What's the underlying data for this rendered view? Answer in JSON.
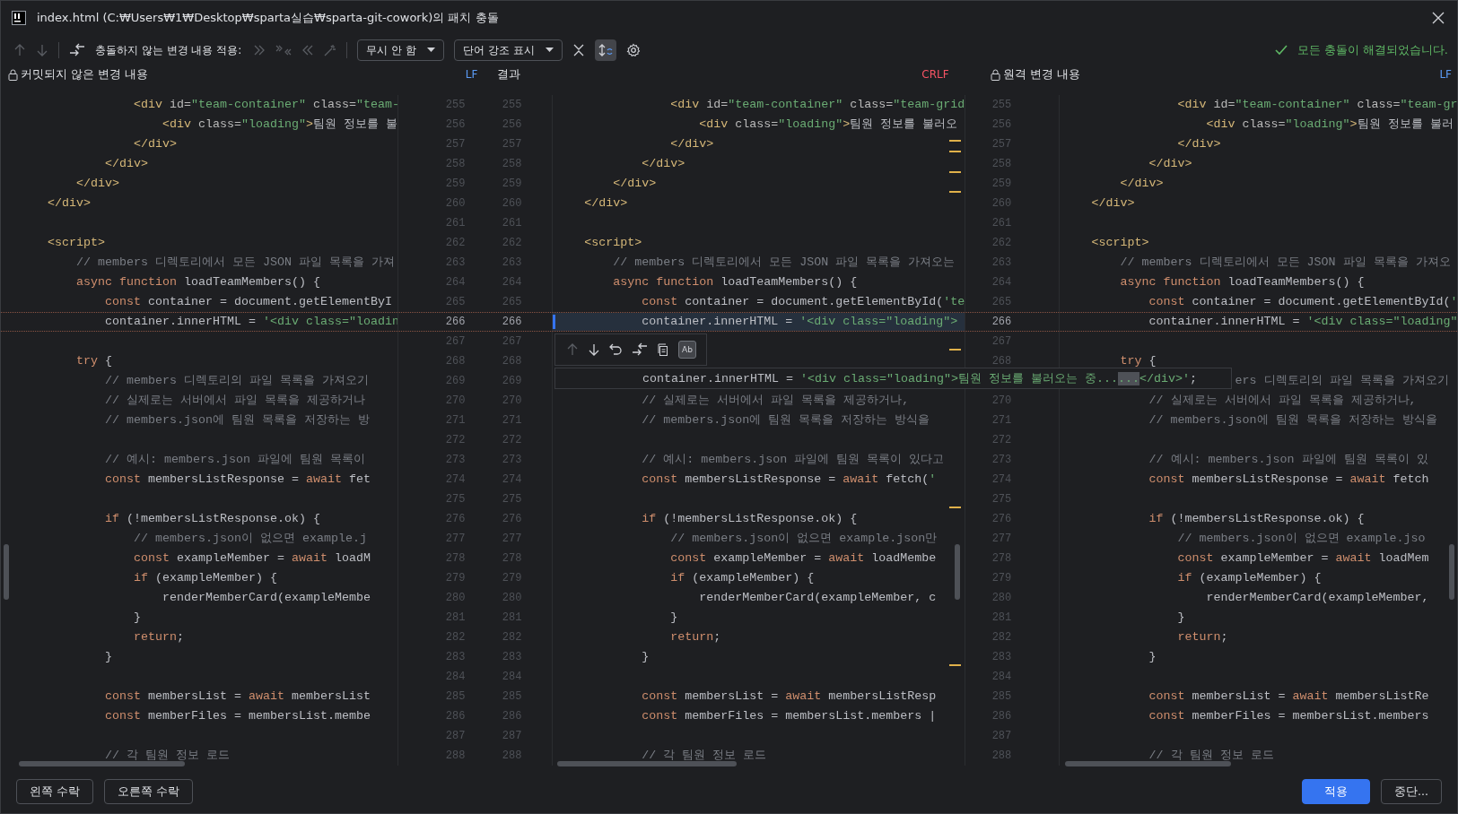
{
  "window": {
    "title": "index.html (C:₩Users₩1₩Desktop₩sparta실습₩sparta-git-cowork)의 패치 충돌"
  },
  "toolbar": {
    "apply_label": "충돌하지 않는 변경 내용 적용:",
    "dropdowns": [
      {
        "label": "무시 안 함"
      },
      {
        "label": "단어 강조 표시"
      }
    ],
    "sync_scroll": {
      "selected": true
    },
    "status": "모든 충돌이 해결되었습니다."
  },
  "headers": {
    "left": {
      "title": "커밋되지 않은 변경 내용",
      "line_ending": "LF",
      "mismatch": false
    },
    "result": {
      "title": "결과",
      "line_ending": "CRLF",
      "mismatch": true
    },
    "right": {
      "title": "원격 변경 내용",
      "line_ending": "LF",
      "mismatch": false
    }
  },
  "rows": [
    {
      "left_no": "255",
      "result_no": "255",
      "right_no": "255",
      "conflict": false,
      "left": [
        {
          "kind": "tag",
          "text": "                <div"
        },
        {
          "kind": "attr",
          "text": " id="
        },
        {
          "kind": "str",
          "text": "\"team-container\""
        },
        {
          "kind": "attr",
          "text": " class="
        },
        {
          "kind": "str",
          "text": "\"team-"
        }
      ],
      "result": [
        {
          "kind": "tag",
          "text": "                <div"
        },
        {
          "kind": "attr",
          "text": " id="
        },
        {
          "kind": "str",
          "text": "\"team-container\""
        },
        {
          "kind": "attr",
          "text": " class="
        },
        {
          "kind": "str",
          "text": "\"team-grid"
        }
      ],
      "right": [
        {
          "kind": "tag",
          "text": "                <div"
        },
        {
          "kind": "attr",
          "text": " id="
        },
        {
          "kind": "str",
          "text": "\"team-container\""
        },
        {
          "kind": "attr",
          "text": " class="
        },
        {
          "kind": "str",
          "text": "\"team-gr"
        }
      ]
    },
    {
      "left_no": "256",
      "result_no": "256",
      "right_no": "256",
      "conflict": false,
      "left": [
        {
          "kind": "tag",
          "text": "                    <div"
        },
        {
          "kind": "attr",
          "text": " class="
        },
        {
          "kind": "str",
          "text": "\"loading\""
        },
        {
          "kind": "tag",
          "text": ">"
        },
        {
          "kind": "plain",
          "text": "팀원 정보를 불"
        }
      ],
      "result": [
        {
          "kind": "tag",
          "text": "                    <div"
        },
        {
          "kind": "attr",
          "text": " class="
        },
        {
          "kind": "str",
          "text": "\"loading\""
        },
        {
          "kind": "tag",
          "text": ">"
        },
        {
          "kind": "plain",
          "text": "팀원 정보를 불러오"
        }
      ],
      "right": [
        {
          "kind": "tag",
          "text": "                    <div"
        },
        {
          "kind": "attr",
          "text": " class="
        },
        {
          "kind": "str",
          "text": "\"loading\""
        },
        {
          "kind": "tag",
          "text": ">"
        },
        {
          "kind": "plain",
          "text": "팀원 정보를 불러"
        }
      ]
    },
    {
      "left_no": "257",
      "result_no": "257",
      "right_no": "257",
      "conflict": false,
      "marker": {
        "kind": "double"
      },
      "left": [
        {
          "kind": "tag",
          "text": "                </div>"
        }
      ],
      "result": [
        {
          "kind": "tag",
          "text": "                </div>"
        }
      ],
      "right": [
        {
          "kind": "tag",
          "text": "                </div>"
        }
      ]
    },
    {
      "left_no": "258",
      "result_no": "258",
      "right_no": "258",
      "conflict": false,
      "marker": {
        "kind": "single"
      },
      "left": [
        {
          "kind": "tag",
          "text": "            </div>"
        }
      ],
      "result": [
        {
          "kind": "tag",
          "text": "            </div>"
        }
      ],
      "right": [
        {
          "kind": "tag",
          "text": "            </div>"
        }
      ]
    },
    {
      "left_no": "259",
      "result_no": "259",
      "right_no": "259",
      "conflict": false,
      "marker": {
        "kind": "single"
      },
      "left": [
        {
          "kind": "tag",
          "text": "        </div>"
        }
      ],
      "result": [
        {
          "kind": "tag",
          "text": "        </div>"
        }
      ],
      "right": [
        {
          "kind": "tag",
          "text": "        </div>"
        }
      ]
    },
    {
      "left_no": "260",
      "result_no": "260",
      "right_no": "260",
      "conflict": false,
      "left": [
        {
          "kind": "tag",
          "text": "    </div>"
        }
      ],
      "result": [
        {
          "kind": "tag",
          "text": "    </div>"
        }
      ],
      "right": [
        {
          "kind": "tag",
          "text": "    </div>"
        }
      ]
    },
    {
      "left_no": "261",
      "result_no": "261",
      "right_no": "261",
      "conflict": false,
      "left": [],
      "result": [],
      "right": []
    },
    {
      "left_no": "262",
      "result_no": "262",
      "right_no": "262",
      "conflict": false,
      "left": [
        {
          "kind": "tag",
          "text": "    <script>"
        }
      ],
      "result": [
        {
          "kind": "tag",
          "text": "    <script>"
        }
      ],
      "right": [
        {
          "kind": "tag",
          "text": "    <script>"
        }
      ]
    },
    {
      "left_no": "263",
      "result_no": "263",
      "right_no": "263",
      "conflict": false,
      "left": [
        {
          "kind": "comment",
          "text": "        // members 디렉토리에서 모든 JSON 파일 목록을 가져"
        }
      ],
      "result": [
        {
          "kind": "comment",
          "text": "        // members 디렉토리에서 모든 JSON 파일 목록을 가져오는"
        }
      ],
      "right": [
        {
          "kind": "comment",
          "text": "        // members 디렉토리에서 모든 JSON 파일 목록을 가져오"
        }
      ]
    },
    {
      "left_no": "264",
      "result_no": "264",
      "right_no": "264",
      "conflict": false,
      "left": [
        {
          "kind": "kw",
          "text": "        async function"
        },
        {
          "kind": "plain",
          "text": " loadTeamMembers() {"
        }
      ],
      "result": [
        {
          "kind": "kw",
          "text": "        async function"
        },
        {
          "kind": "plain",
          "text": " loadTeamMembers() {"
        }
      ],
      "right": [
        {
          "kind": "kw",
          "text": "        async function"
        },
        {
          "kind": "plain",
          "text": " loadTeamMembers() {"
        }
      ]
    },
    {
      "left_no": "265",
      "result_no": "265",
      "right_no": "265",
      "conflict": false,
      "left": [
        {
          "kind": "kw",
          "text": "            const"
        },
        {
          "kind": "plain",
          "text": " container = document.getElementByI"
        }
      ],
      "result": [
        {
          "kind": "kw",
          "text": "            const"
        },
        {
          "kind": "plain",
          "text": " container = document.getElementById("
        },
        {
          "kind": "str",
          "text": "'te"
        }
      ],
      "right": [
        {
          "kind": "kw",
          "text": "            const"
        },
        {
          "kind": "plain",
          "text": " container = document.getElementById("
        },
        {
          "kind": "str",
          "text": "'"
        }
      ]
    },
    {
      "left_no": "266",
      "result_no": "266",
      "right_no": "266",
      "conflict": true,
      "left": [
        {
          "kind": "plain",
          "text": "            container.innerHTML = "
        },
        {
          "kind": "str",
          "text": "'<div class=\"loadin"
        }
      ],
      "result": [
        {
          "kind": "plain",
          "text": "            container.innerHTML = "
        },
        {
          "kind": "str",
          "text": "'<div class=\"loading\">"
        }
      ],
      "right": [
        {
          "kind": "plain",
          "text": "            container.innerHTML = "
        },
        {
          "kind": "str",
          "text": "'<div class=\"loading\""
        }
      ]
    },
    {
      "left_no": "267",
      "result_no": "267",
      "right_no": "267",
      "conflict": false,
      "marker": {
        "kind": "single"
      },
      "left": [],
      "result": [],
      "right": []
    },
    {
      "left_no": "268",
      "result_no": "268",
      "right_no": "268",
      "conflict": false,
      "left": [
        {
          "kind": "kw",
          "text": "        try"
        },
        {
          "kind": "plain",
          "text": " {"
        }
      ],
      "result": [],
      "right": [
        {
          "kind": "kw",
          "text": "        try"
        },
        {
          "kind": "plain",
          "text": " {"
        }
      ]
    },
    {
      "left_no": "269",
      "result_no": "269",
      "conflict": false,
      "left": [
        {
          "kind": "comment",
          "text": "            // members 디렉토리의 파일 목록을 가져오기"
        }
      ],
      "result": [],
      "right": [
        {
          "kind": "comment",
          "text": "                        ers 디렉토리의 파일 목록을 가져오기"
        }
      ]
    },
    {
      "left_no": "270",
      "result_no": "270",
      "right_no": "270",
      "conflict": false,
      "left": [
        {
          "kind": "comment",
          "text": "            // 실제로는 서버에서 파일 목록을 제공하거나"
        }
      ],
      "result": [
        {
          "kind": "comment",
          "text": "            // 실제로는 서버에서 파일 목록을 제공하거나,"
        }
      ],
      "right": [
        {
          "kind": "comment",
          "text": "            // 실제로는 서버에서 파일 목록을 제공하거나,"
        }
      ]
    },
    {
      "left_no": "271",
      "result_no": "271",
      "right_no": "271",
      "conflict": false,
      "left": [
        {
          "kind": "comment",
          "text": "            // members.json에 팀원 목록을 저장하는 방"
        }
      ],
      "result": [
        {
          "kind": "comment",
          "text": "            // members.json에 팀원 목록을 저장하는 방식을"
        }
      ],
      "right": [
        {
          "kind": "comment",
          "text": "            // members.json에 팀원 목록을 저장하는 방식을"
        }
      ]
    },
    {
      "left_no": "272",
      "result_no": "272",
      "right_no": "272",
      "conflict": false,
      "left": [],
      "result": [],
      "right": []
    },
    {
      "left_no": "273",
      "result_no": "273",
      "right_no": "273",
      "conflict": false,
      "left": [
        {
          "kind": "comment",
          "text": "            // 예시: members.json 파일에 팀원 목록이"
        }
      ],
      "result": [
        {
          "kind": "comment",
          "text": "            // 예시: members.json 파일에 팀원 목록이 있다고"
        }
      ],
      "right": [
        {
          "kind": "comment",
          "text": "            // 예시: members.json 파일에 팀원 목록이 있"
        }
      ]
    },
    {
      "left_no": "274",
      "result_no": "274",
      "right_no": "274",
      "conflict": false,
      "left": [
        {
          "kind": "kw",
          "text": "            const"
        },
        {
          "kind": "plain",
          "text": " membersListResponse = "
        },
        {
          "kind": "kw",
          "text": "await"
        },
        {
          "kind": "plain",
          "text": " fet"
        }
      ],
      "result": [
        {
          "kind": "kw",
          "text": "            const"
        },
        {
          "kind": "plain",
          "text": " membersListResponse = "
        },
        {
          "kind": "kw",
          "text": "await"
        },
        {
          "kind": "plain",
          "text": " fetch("
        },
        {
          "kind": "str",
          "text": "'"
        }
      ],
      "right": [
        {
          "kind": "kw",
          "text": "            const"
        },
        {
          "kind": "plain",
          "text": " membersListResponse = "
        },
        {
          "kind": "kw",
          "text": "await"
        },
        {
          "kind": "plain",
          "text": " fetch"
        }
      ]
    },
    {
      "left_no": "275",
      "result_no": "275",
      "right_no": "275",
      "conflict": false,
      "marker": {
        "kind": "single"
      },
      "left": [],
      "result": [],
      "right": []
    },
    {
      "left_no": "276",
      "result_no": "276",
      "right_no": "276",
      "conflict": false,
      "left": [
        {
          "kind": "kw",
          "text": "            if"
        },
        {
          "kind": "plain",
          "text": " (!membersListResponse.ok) {"
        }
      ],
      "result": [
        {
          "kind": "kw",
          "text": "            if"
        },
        {
          "kind": "plain",
          "text": " (!membersListResponse.ok) {"
        }
      ],
      "right": [
        {
          "kind": "kw",
          "text": "            if"
        },
        {
          "kind": "plain",
          "text": " (!membersListResponse.ok) {"
        }
      ]
    },
    {
      "left_no": "277",
      "result_no": "277",
      "right_no": "277",
      "conflict": false,
      "left": [
        {
          "kind": "comment",
          "text": "                // members.json이 없으면 example.j"
        }
      ],
      "result": [
        {
          "kind": "comment",
          "text": "                // members.json이 없으면 example.json만"
        }
      ],
      "right": [
        {
          "kind": "comment",
          "text": "                // members.json이 없으면 example.jso"
        }
      ]
    },
    {
      "left_no": "278",
      "result_no": "278",
      "right_no": "278",
      "conflict": false,
      "left": [
        {
          "kind": "kw",
          "text": "                const"
        },
        {
          "kind": "plain",
          "text": " exampleMember = "
        },
        {
          "kind": "kw",
          "text": "await"
        },
        {
          "kind": "plain",
          "text": " loadM"
        }
      ],
      "result": [
        {
          "kind": "kw",
          "text": "                const"
        },
        {
          "kind": "plain",
          "text": " exampleMember = "
        },
        {
          "kind": "kw",
          "text": "await"
        },
        {
          "kind": "plain",
          "text": " loadMembe"
        }
      ],
      "right": [
        {
          "kind": "kw",
          "text": "                const"
        },
        {
          "kind": "plain",
          "text": " exampleMember = "
        },
        {
          "kind": "kw",
          "text": "await"
        },
        {
          "kind": "plain",
          "text": " loadMem"
        }
      ]
    },
    {
      "left_no": "279",
      "result_no": "279",
      "right_no": "279",
      "conflict": false,
      "left": [
        {
          "kind": "kw",
          "text": "                if"
        },
        {
          "kind": "plain",
          "text": " (exampleMember) {"
        }
      ],
      "result": [
        {
          "kind": "kw",
          "text": "                if"
        },
        {
          "kind": "plain",
          "text": " (exampleMember) {"
        }
      ],
      "right": [
        {
          "kind": "kw",
          "text": "                if"
        },
        {
          "kind": "plain",
          "text": " (exampleMember) {"
        }
      ]
    },
    {
      "left_no": "280",
      "result_no": "280",
      "right_no": "280",
      "conflict": false,
      "left": [
        {
          "kind": "plain",
          "text": "                    renderMemberCard(exampleMembe"
        }
      ],
      "result": [
        {
          "kind": "plain",
          "text": "                    renderMemberCard(exampleMember, c"
        }
      ],
      "right": [
        {
          "kind": "plain",
          "text": "                    renderMemberCard(exampleMember,"
        }
      ]
    },
    {
      "left_no": "281",
      "result_no": "281",
      "right_no": "281",
      "conflict": false,
      "left": [
        {
          "kind": "plain",
          "text": "                }"
        }
      ],
      "result": [
        {
          "kind": "plain",
          "text": "                }"
        }
      ],
      "right": [
        {
          "kind": "plain",
          "text": "                }"
        }
      ]
    },
    {
      "left_no": "282",
      "result_no": "282",
      "right_no": "282",
      "conflict": false,
      "left": [
        {
          "kind": "kw",
          "text": "                return"
        },
        {
          "kind": "plain",
          "text": ";"
        }
      ],
      "result": [
        {
          "kind": "kw",
          "text": "                return"
        },
        {
          "kind": "plain",
          "text": ";"
        }
      ],
      "right": [
        {
          "kind": "kw",
          "text": "                return"
        },
        {
          "kind": "plain",
          "text": ";"
        }
      ]
    },
    {
      "left_no": "283",
      "result_no": "283",
      "right_no": "283",
      "conflict": false,
      "marker": {
        "kind": "single"
      },
      "left": [
        {
          "kind": "plain",
          "text": "            }"
        }
      ],
      "result": [
        {
          "kind": "plain",
          "text": "            }"
        }
      ],
      "right": [
        {
          "kind": "plain",
          "text": "            }"
        }
      ]
    },
    {
      "left_no": "284",
      "result_no": "284",
      "right_no": "284",
      "conflict": false,
      "left": [],
      "result": [],
      "right": []
    },
    {
      "left_no": "285",
      "result_no": "285",
      "right_no": "285",
      "conflict": false,
      "left": [
        {
          "kind": "kw",
          "text": "            const"
        },
        {
          "kind": "plain",
          "text": " membersList = "
        },
        {
          "kind": "kw",
          "text": "await"
        },
        {
          "kind": "plain",
          "text": " membersList"
        }
      ],
      "result": [
        {
          "kind": "kw",
          "text": "            const"
        },
        {
          "kind": "plain",
          "text": " membersList = "
        },
        {
          "kind": "kw",
          "text": "await"
        },
        {
          "kind": "plain",
          "text": " membersListResp"
        }
      ],
      "right": [
        {
          "kind": "kw",
          "text": "            const"
        },
        {
          "kind": "plain",
          "text": " membersList = "
        },
        {
          "kind": "kw",
          "text": "await"
        },
        {
          "kind": "plain",
          "text": " membersListRe"
        }
      ]
    },
    {
      "left_no": "286",
      "result_no": "286",
      "right_no": "286",
      "conflict": false,
      "left": [
        {
          "kind": "kw",
          "text": "            const"
        },
        {
          "kind": "plain",
          "text": " memberFiles = membersList.membe"
        }
      ],
      "result": [
        {
          "kind": "kw",
          "text": "            const"
        },
        {
          "kind": "plain",
          "text": " memberFiles = membersList.members |"
        }
      ],
      "right": [
        {
          "kind": "kw",
          "text": "            const"
        },
        {
          "kind": "plain",
          "text": " memberFiles = membersList.members"
        }
      ]
    },
    {
      "left_no": "287",
      "result_no": "287",
      "right_no": "287",
      "conflict": false,
      "left": [],
      "result": [],
      "right": []
    },
    {
      "left_no": "288",
      "result_no": "288",
      "right_no": "288",
      "conflict": false,
      "left": [
        {
          "kind": "comment",
          "text": "            // 각 팀원 정보 로드"
        }
      ],
      "result": [
        {
          "kind": "comment",
          "text": "            // 각 팀원 정보 로드"
        }
      ],
      "right": [
        {
          "kind": "comment",
          "text": "            // 각 팀원 정보 로드"
        }
      ]
    }
  ],
  "popup": {
    "word_diff": {
      "label": "Ab",
      "selected": true
    },
    "segments": [
      {
        "kind": "plain",
        "text": "            container.innerHTML = "
      },
      {
        "kind": "str",
        "text": "'<div class=\"loading\">팀원 정보를 불러오는 중..."
      },
      {
        "kind": "diff",
        "text": "..."
      },
      {
        "kind": "str",
        "text": "</div>'"
      },
      {
        "kind": "plain",
        "text": ";"
      }
    ]
  },
  "buttons": {
    "left": [
      {
        "label": "왼쪽 수락"
      },
      {
        "label": "오른쪽 수락"
      }
    ],
    "right": [
      {
        "label": "적용",
        "primary": true
      },
      {
        "label": "중단...",
        "primary": false
      }
    ]
  }
}
